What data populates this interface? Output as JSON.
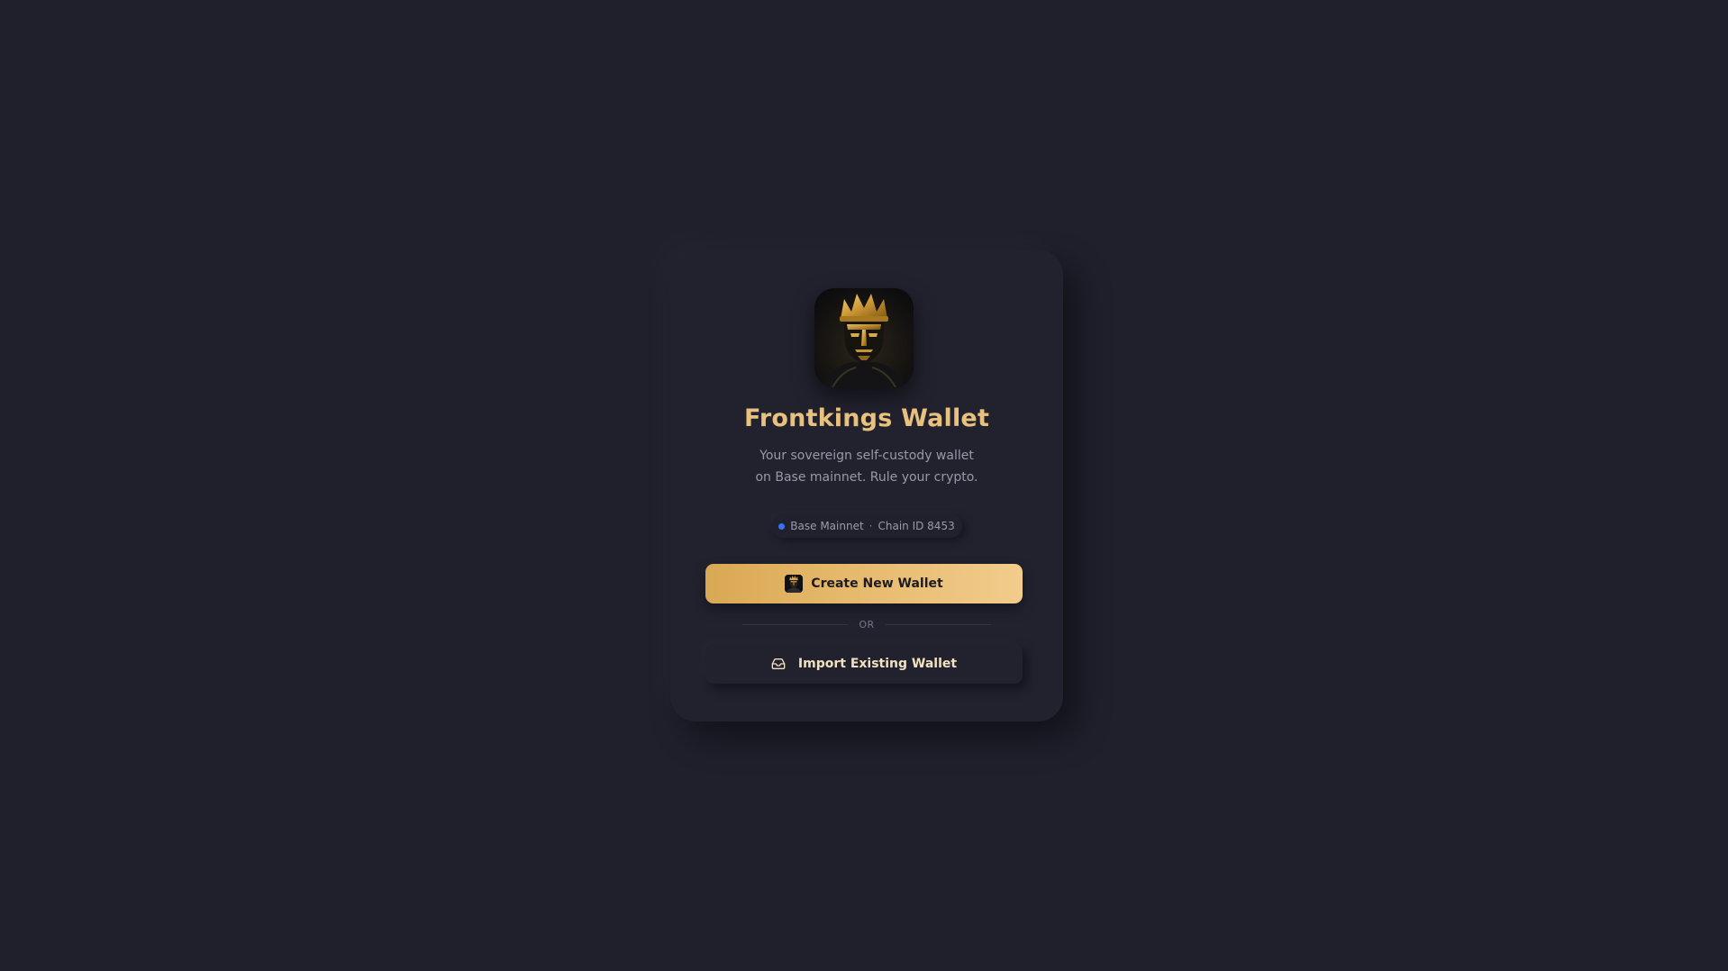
{
  "app": {
    "title": "Frontkings Wallet",
    "subtitle_line1": "Your sovereign self-custody wallet",
    "subtitle_line2": "on Base mainnet. Rule your crypto."
  },
  "network": {
    "name": "Base Mainnet",
    "separator": "·",
    "chain": "Chain ID 8453",
    "status_color": "#3b6ff5"
  },
  "actions": {
    "create_label": "Create New Wallet",
    "divider_label": "OR",
    "import_label": "Import Existing Wallet"
  },
  "icons": {
    "logo": "crowned-mask-logo",
    "create": "crowned-mask-logo",
    "import": "inbox-icon"
  },
  "colors": {
    "background": "#20202d",
    "accent_gold": "#e8c17e",
    "button_gradient_start": "#d9a854",
    "button_gradient_end": "#f2cc8c"
  }
}
